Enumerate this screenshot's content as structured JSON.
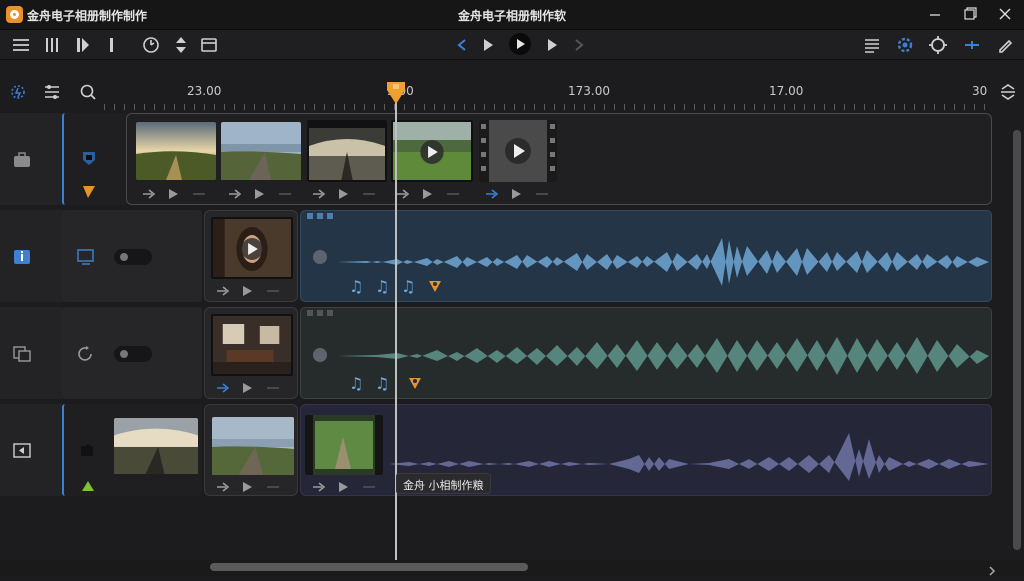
{
  "window": {
    "app_name": "金舟电子相册制作制作",
    "title": "金舟电子相册制作软",
    "controls": [
      "minimize-icon",
      "maximize-icon",
      "close-icon"
    ]
  },
  "toolbar": {
    "left_icons": [
      "menu-icon",
      "columns-icon",
      "split-clip-icon",
      "marker-icon",
      "speed-icon",
      "sort-icon",
      "layout-icon"
    ],
    "transport_icons": [
      "previous-icon",
      "play-icon",
      "play-pause-icon",
      "forward-icon",
      "next-icon"
    ],
    "right_icons": [
      "list-icon",
      "settings-icon",
      "sync-icon",
      "add-icon",
      "edit-icon"
    ]
  },
  "timeline": {
    "tools": [
      "snap-icon",
      "track-settings-icon",
      "zoom-icon"
    ],
    "ruler_labels": [
      "23.00",
      "3.00",
      "173.00",
      "17.00",
      "30"
    ],
    "tooltip": "金舟 小相制作粮"
  },
  "tracks": [
    {
      "head_icon": "briefcase-icon",
      "ctrl_icons": [
        "shield-icon",
        "flag-icon"
      ],
      "clips": [
        "field-sunset",
        "coast-path",
        "wet-pier",
        "green-meadow",
        "film-reel"
      ]
    },
    {
      "head_icon": "info-panel-icon",
      "ctrl_icons": [
        "monitor-icon",
        "toggle-switch"
      ],
      "clips": [
        "woman-portrait"
      ],
      "audio_badges": [
        "music-note-icon",
        "music-note-icon",
        "music-note-icon",
        "marker-icon"
      ]
    },
    {
      "head_icon": "image-copy-icon",
      "ctrl_icons": [
        "rotate-icon",
        "toggle-switch"
      ],
      "clips": [
        "living-room"
      ],
      "audio_badges": [
        "music-note-icon",
        "music-note-icon",
        "marker-icon"
      ]
    },
    {
      "head_icon": "play-left-icon",
      "ctrl_icons": [
        "puzzle-icon",
        "triangle-icon"
      ],
      "clips": [
        "sunset-pier",
        "coast-path",
        "forest-path"
      ]
    }
  ],
  "colors": {
    "accent": "#e9922b",
    "playhead": "#f0a030",
    "audio_blue": "#6aa0cc",
    "audio_green": "#5c8f86",
    "audio_purple": "#7a7fb3",
    "selection": "#3d7fd0"
  },
  "scroll": {
    "horizontal_position": 0.0,
    "horizontal_visible_fraction": 0.35
  }
}
